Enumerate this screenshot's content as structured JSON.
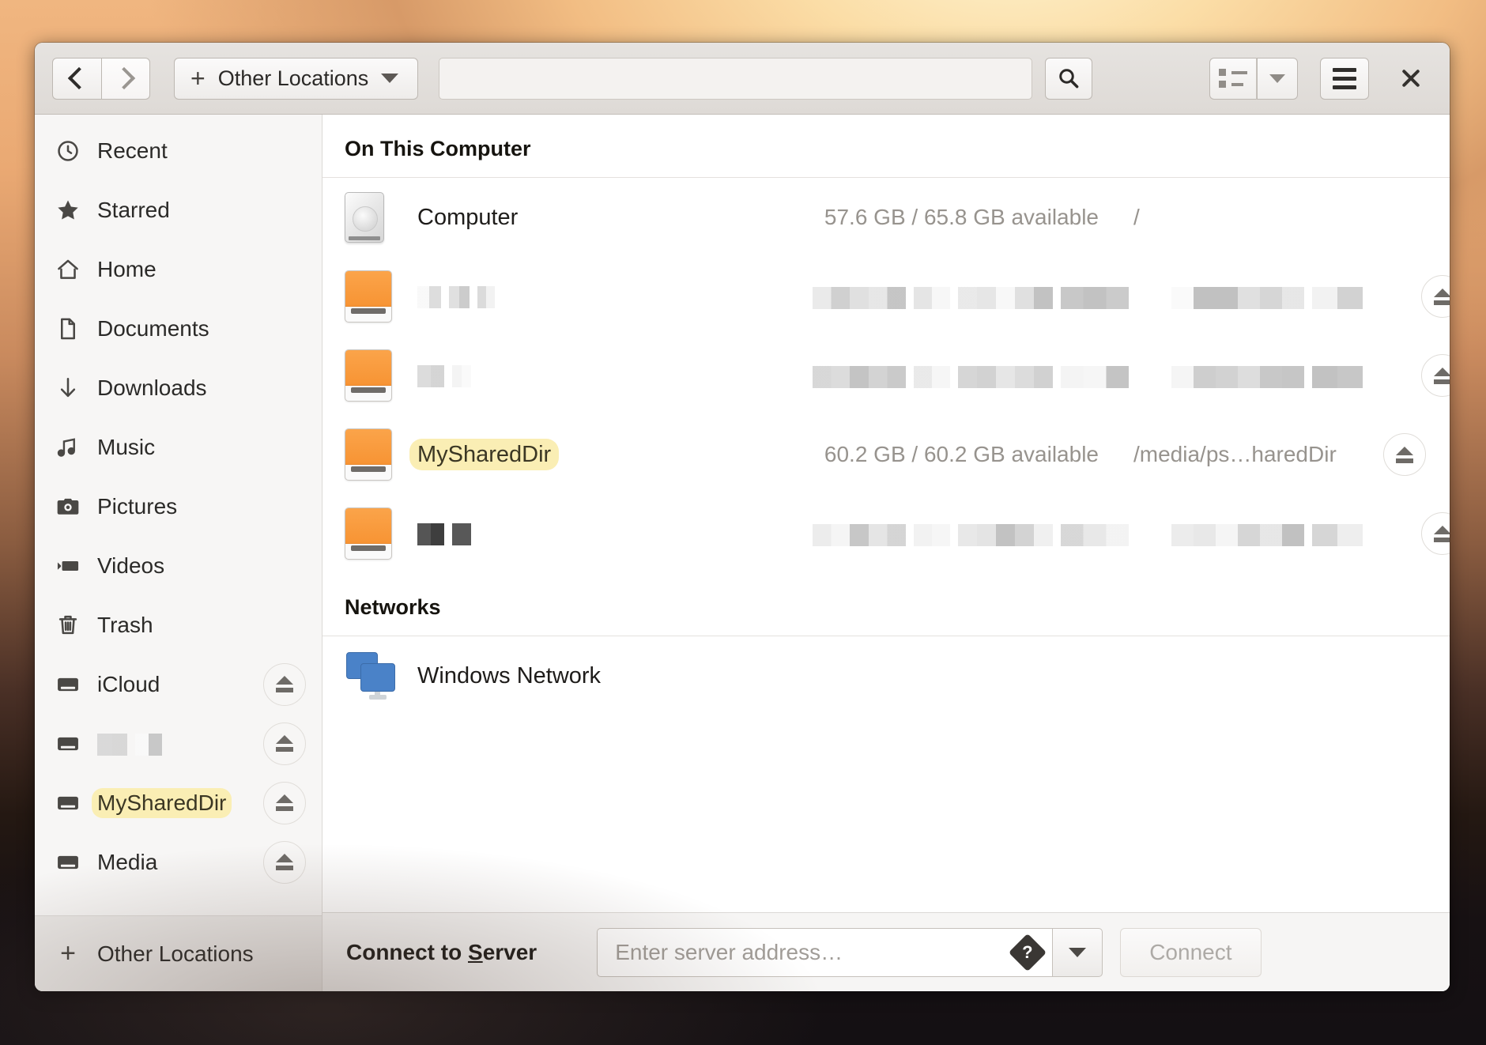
{
  "window": {
    "title": "Other Locations"
  },
  "header": {
    "back_icon": "chevron-left-icon",
    "forward_icon": "chevron-right-icon",
    "path_plus": "+",
    "path_label": "Other Locations",
    "path_caret_icon": "chevron-down-icon",
    "search_icon": "search-icon",
    "view_list_icon": "list-view-icon",
    "view_caret_icon": "chevron-down-icon",
    "menu_icon": "hamburger-menu-icon",
    "close_icon": "close-icon"
  },
  "sidebar": {
    "items": [
      {
        "label": "Recent",
        "icon": "clock-icon",
        "eject": false,
        "highlight": false,
        "redacted": false
      },
      {
        "label": "Starred",
        "icon": "star-icon",
        "eject": false,
        "highlight": false,
        "redacted": false
      },
      {
        "label": "Home",
        "icon": "home-icon",
        "eject": false,
        "highlight": false,
        "redacted": false
      },
      {
        "label": "Documents",
        "icon": "document-icon",
        "eject": false,
        "highlight": false,
        "redacted": false
      },
      {
        "label": "Downloads",
        "icon": "download-icon",
        "eject": false,
        "highlight": false,
        "redacted": false
      },
      {
        "label": "Music",
        "icon": "music-icon",
        "eject": false,
        "highlight": false,
        "redacted": false
      },
      {
        "label": "Pictures",
        "icon": "camera-icon",
        "eject": false,
        "highlight": false,
        "redacted": false
      },
      {
        "label": "Videos",
        "icon": "video-icon",
        "eject": false,
        "highlight": false,
        "redacted": false
      },
      {
        "label": "Trash",
        "icon": "trash-icon",
        "eject": false,
        "highlight": false,
        "redacted": false
      },
      {
        "label": "iCloud",
        "icon": "drive-icon",
        "eject": true,
        "highlight": false,
        "redacted": false
      },
      {
        "label": "",
        "icon": "drive-icon",
        "eject": true,
        "highlight": false,
        "redacted": true
      },
      {
        "label": "MySharedDir",
        "icon": "drive-icon",
        "eject": true,
        "highlight": true,
        "redacted": false
      },
      {
        "label": "Media",
        "icon": "drive-icon",
        "eject": true,
        "highlight": false,
        "redacted": false
      }
    ],
    "footer": {
      "plus": "+",
      "label": "Other Locations"
    }
  },
  "main": {
    "sections": [
      {
        "title": "On This Computer",
        "rows": [
          {
            "name": "Computer",
            "icon": "hard-drive-icon",
            "size": "57.6 GB / 65.8 GB available",
            "path": "/",
            "eject": false,
            "highlight": false,
            "redacted": false
          },
          {
            "name": "",
            "icon": "removable-drive-icon",
            "size": "",
            "path": "",
            "eject": true,
            "highlight": false,
            "redacted": true
          },
          {
            "name": "",
            "icon": "removable-drive-icon",
            "size": "",
            "path": "",
            "eject": true,
            "highlight": false,
            "redacted": true
          },
          {
            "name": "MySharedDir",
            "icon": "removable-drive-icon",
            "size": "60.2 GB / 60.2 GB available",
            "path": "/media/ps…haredDir",
            "eject": true,
            "highlight": true,
            "redacted": false
          },
          {
            "name": "",
            "icon": "removable-drive-icon",
            "size": "",
            "path": "",
            "eject": true,
            "highlight": false,
            "redacted": true
          }
        ]
      },
      {
        "title": "Networks",
        "rows": [
          {
            "name": "Windows Network",
            "icon": "network-computers-icon",
            "size": "",
            "path": "",
            "eject": false,
            "highlight": false,
            "redacted": false
          }
        ]
      }
    ]
  },
  "bottom": {
    "label_prefix": "Connect to ",
    "label_mnemonic": "S",
    "label_suffix": "erver",
    "server_placeholder": "Enter server address…",
    "server_value": "",
    "help_icon": "help-icon",
    "dropdown_icon": "chevron-down-icon",
    "connect_label": "Connect"
  },
  "colors": {
    "highlight_yellow": "#faeeb4",
    "drive_orange": "#f79434",
    "network_blue": "#4a82c8",
    "muted_text": "#97938e"
  }
}
